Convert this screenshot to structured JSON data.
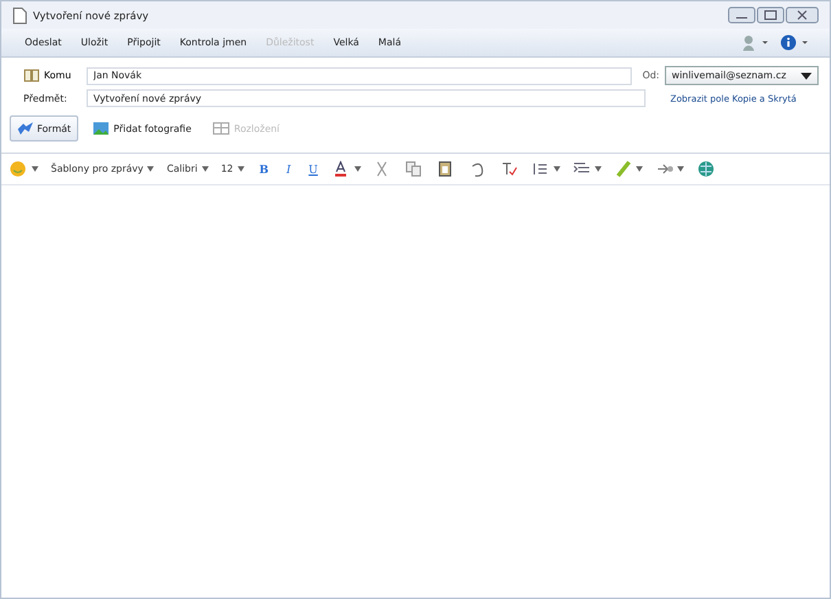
{
  "window": {
    "title": "Vytvoření nové zprávy"
  },
  "menu": [
    {
      "label": "Odeslat",
      "disabled": false
    },
    {
      "label": "Uložit",
      "disabled": false
    },
    {
      "label": "Připojit",
      "disabled": false
    },
    {
      "label": "Kontrola jmen",
      "disabled": false
    },
    {
      "label": "Důležitost",
      "disabled": true
    },
    {
      "label": "Velká",
      "disabled": false
    },
    {
      "label": "Malá",
      "disabled": false
    }
  ],
  "to": {
    "label": "Komu",
    "value": "Jan Novák"
  },
  "subject": {
    "label": "Předmět:",
    "value": "Vytvoření nové zprávy"
  },
  "from": {
    "label": "Od:",
    "value": "winlivemail@seznam.cz"
  },
  "show_cc_link": "Zobrazit pole Kopie a Skrytá",
  "mode_buttons": [
    {
      "label": "Formát",
      "selected": true,
      "disabled": false
    },
    {
      "label": "Přidat fotografie",
      "selected": false,
      "disabled": false
    },
    {
      "label": "Rozložení",
      "selected": false,
      "disabled": true
    }
  ],
  "format_toolbar": [
    {
      "kind": "emoji"
    },
    {
      "kind": "dropdown",
      "label": "Šablony pro zprávy"
    },
    {
      "kind": "dropdown",
      "label": "Calibri"
    },
    {
      "kind": "dropdown",
      "label": "12"
    },
    {
      "kind": "letter",
      "label": "B",
      "color": "#2a6fd6"
    },
    {
      "kind": "letter",
      "label": "I",
      "color": "#2a6fd6"
    },
    {
      "kind": "letter",
      "label": "U",
      "color": "#2a6fd6"
    },
    {
      "kind": "fontcolor"
    },
    {
      "kind": "cut"
    },
    {
      "kind": "copy"
    },
    {
      "kind": "paste"
    },
    {
      "kind": "undo"
    },
    {
      "kind": "spell"
    },
    {
      "kind": "list"
    },
    {
      "kind": "indent"
    },
    {
      "kind": "highlight"
    },
    {
      "kind": "link"
    },
    {
      "kind": "globe"
    }
  ]
}
